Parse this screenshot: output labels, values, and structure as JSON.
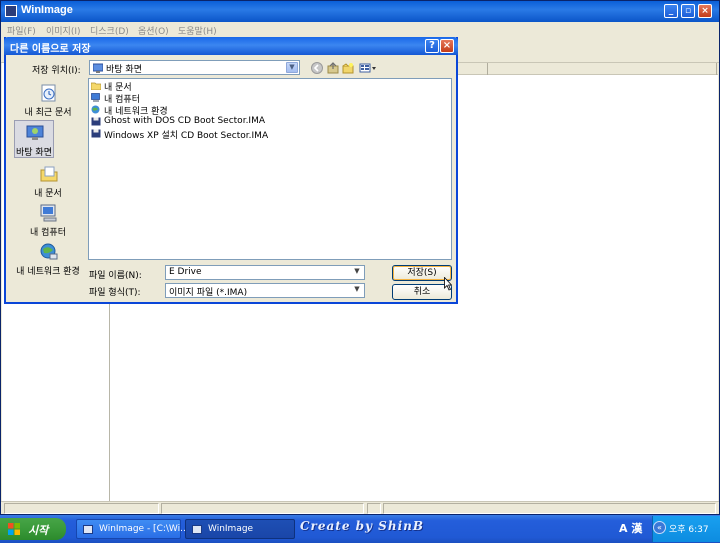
{
  "main_window": {
    "title": "WinImage",
    "menu": [
      "파일(F)",
      "이미지(I)",
      "디스크(D)",
      "옵션(O)",
      "도움말(H)"
    ],
    "minimize": "_",
    "maximize": "▫",
    "close": "×"
  },
  "dialog": {
    "title": "다른 이름으로 저장",
    "help": "?",
    "close": "×",
    "save_in_label": "저장 위치(I):",
    "save_in_value": "바탕 화면",
    "places": [
      {
        "label": "내 최근 문서",
        "icon": "recent-docs-icon"
      },
      {
        "label": "바탕 화면",
        "icon": "desktop-icon"
      },
      {
        "label": "내 문서",
        "icon": "my-documents-icon"
      },
      {
        "label": "내 컴퓨터",
        "icon": "my-computer-icon"
      },
      {
        "label": "내 네트워크 환경",
        "icon": "network-icon"
      }
    ],
    "files": [
      {
        "name": "내 문서",
        "icon": "folder-icon"
      },
      {
        "name": "내 컴퓨터",
        "icon": "computer-icon"
      },
      {
        "name": "내 네트워크 환경",
        "icon": "network-icon"
      },
      {
        "name": "Ghost with DOS CD Boot Sector.IMA",
        "icon": "disk-image-icon"
      },
      {
        "name": "Windows XP 설치 CD Boot Sector.IMA",
        "icon": "disk-image-icon"
      }
    ],
    "filename_label": "파일 이름(N):",
    "filename_value": "E Drive",
    "filetype_label": "파일 형식(T):",
    "filetype_value": "이미지 파일 (*.IMA)",
    "save_button": "저장(S)",
    "cancel_button": "취소"
  },
  "taskbar": {
    "start": "시작",
    "tasks": [
      {
        "label": "WinImage - [C:\\Wi...",
        "active": false
      },
      {
        "label": "WinImage",
        "active": true
      }
    ],
    "watermark": "Create by ShinB",
    "ime": "A 漢",
    "chevron": "«",
    "clock": "오후 6:37"
  },
  "colors": {
    "titlebar": "#0a5fd8",
    "dialog_bg": "#ece9d8",
    "taskbar": "#245edb",
    "start": "#3a9a3a"
  }
}
